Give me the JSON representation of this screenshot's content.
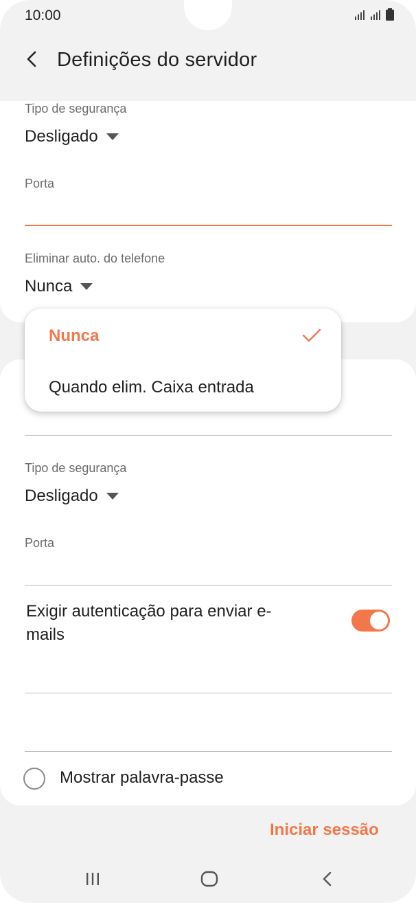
{
  "status_bar": {
    "time": "10:00",
    "icons": [
      "signal-1-icon",
      "signal-2-icon",
      "battery-icon"
    ]
  },
  "header": {
    "back_icon": "back-arrow-icon",
    "title": "Definições do servidor"
  },
  "incoming": {
    "security_label": "Tipo de segurança",
    "security_value": "Desligado",
    "port_label": "Porta",
    "port_value": "",
    "auto_delete_label": "Eliminar auto. do telefone",
    "auto_delete_value": "Nunca"
  },
  "dropdown": {
    "options": [
      {
        "label": "Nunca",
        "selected": true
      },
      {
        "label": "Quando elim. Caixa entrada",
        "selected": false
      }
    ]
  },
  "outgoing": {
    "security_label": "Tipo de segurança",
    "security_value": "Desligado",
    "port_label": "Porta",
    "port_value": "",
    "require_auth_label": "Exigir autenticação para enviar e-mails",
    "require_auth_enabled": true
  },
  "show_password": {
    "label": "Mostrar palavra-passe",
    "checked": false
  },
  "actions": {
    "login_label": "Iniciar sessão"
  },
  "nav": {
    "icons": [
      "recent-apps-icon",
      "home-icon",
      "back-icon"
    ]
  },
  "colors": {
    "accent": "#f2784b",
    "background": "#f2f2f2",
    "card": "#ffffff",
    "text": "#1f1f1f",
    "label": "#6b6b6b"
  }
}
